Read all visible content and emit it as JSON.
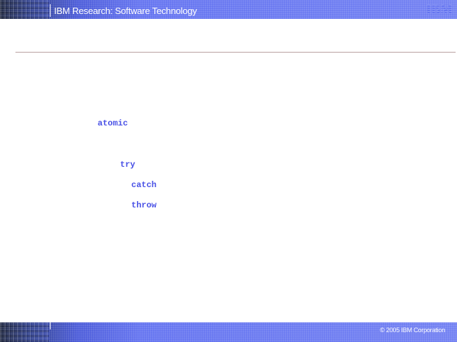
{
  "header": {
    "title": "IBM Research: Software Technology",
    "logo_text": "IBM"
  },
  "code": {
    "keywords": [
      "atomic",
      "try",
      "catch",
      "throw"
    ]
  },
  "footer": {
    "copyright": "© 2005 IBM Corporation"
  },
  "colors": {
    "band_blue": "#5566ee",
    "keyword_blue": "#4a52e6",
    "rule": "#b9a0a0"
  }
}
